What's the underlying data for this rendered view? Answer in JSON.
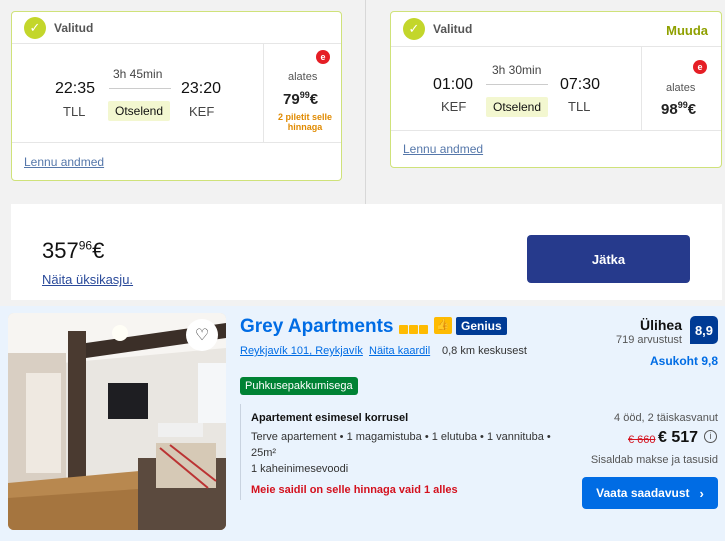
{
  "outbound": {
    "status": "Valitud",
    "dep_time": "22:35",
    "dep_code": "TLL",
    "duration": "3h 45min",
    "stops": "Otselend",
    "arr_time": "23:20",
    "arr_code": "KEF",
    "price_from": "alates",
    "price_main": "79",
    "price_cents": "99",
    "price_currency": "€",
    "seats_note": "2 piletit selle hinnaga",
    "details_link": "Lennu andmed"
  },
  "return": {
    "status": "Valitud",
    "change_link": "Muuda",
    "dep_time": "01:00",
    "dep_code": "KEF",
    "duration": "3h 30min",
    "stops": "Otselend",
    "arr_time": "07:30",
    "arr_code": "TLL",
    "price_from": "alates",
    "price_main": "98",
    "price_cents": "99",
    "price_currency": "€",
    "details_link": "Lennu andmed"
  },
  "summary": {
    "total_main": "357",
    "total_cents": "96",
    "total_currency": "€",
    "breakdown_link": "Näita üksikasju.",
    "continue_label": "Jätka"
  },
  "hotel": {
    "name": "Grey Apartments",
    "stars": 3,
    "genius_label": "Genius",
    "location_link": "Reykjavík 101, Reykjavík",
    "map_link": "Näita kaardil",
    "distance": "0,8 km keskusest",
    "deal_badge": "Puhkusepakkumisega",
    "room_title": "Apartement esimesel korrusel",
    "room_desc_1": "Terve apartement • 1 magamistuba • 1 elutuba • 1 vannituba •",
    "room_desc_2": "25m²",
    "bed_info": "1 kaheinimesevoodi",
    "scarcity": "Meie saidil on selle hinnaga vaid 1 alles",
    "rating_label": "Ülihea",
    "reviews": "719 arvustust",
    "score": "8,9",
    "location_score": "Asukoht 9,8",
    "stay_info": "4 ööd, 2 täiskasvanut",
    "old_price": "€ 660",
    "new_price": "€ 517",
    "taxes_note": "Sisaldab makse ja tasusid",
    "cta_label": "Vaata saadavust"
  },
  "colors": {
    "accent_green": "#c3d62b",
    "primary_blue": "#263a8c",
    "booking_blue": "#006ce4",
    "deal_green": "#008234",
    "alert_red": "#d4111e"
  }
}
